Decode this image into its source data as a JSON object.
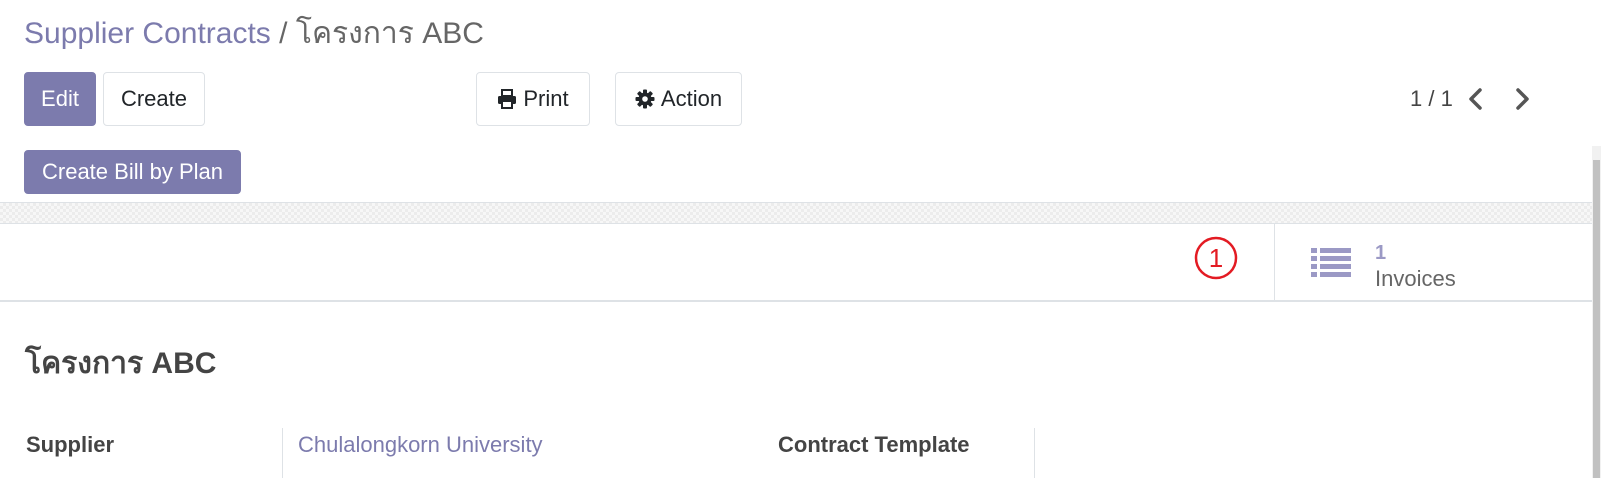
{
  "breadcrumb": {
    "parent": "Supplier Contracts",
    "separator": "/",
    "current": "โครงการ ABC"
  },
  "toolbar": {
    "edit_label": "Edit",
    "create_label": "Create",
    "print_label": "Print",
    "action_label": "Action"
  },
  "pager": {
    "value": "1 / 1"
  },
  "status_bar": {
    "create_bill_label": "Create Bill by Plan"
  },
  "annotation": {
    "label": "1"
  },
  "smart_button": {
    "value": "1",
    "label": "Invoices"
  },
  "record": {
    "title": "โครงการ ABC",
    "fields": {
      "supplier_label": "Supplier",
      "supplier_value": "Chulalongkorn University",
      "contract_template_label": "Contract Template"
    }
  },
  "icons": {
    "print": "printer-icon",
    "action": "gear-icon",
    "prev": "chevron-left-icon",
    "next": "chevron-right-icon",
    "invoices": "list-icon"
  },
  "colors": {
    "brand": "#7c7bad",
    "annotation": "#e31b23",
    "smart_value": "#9b99c5"
  }
}
